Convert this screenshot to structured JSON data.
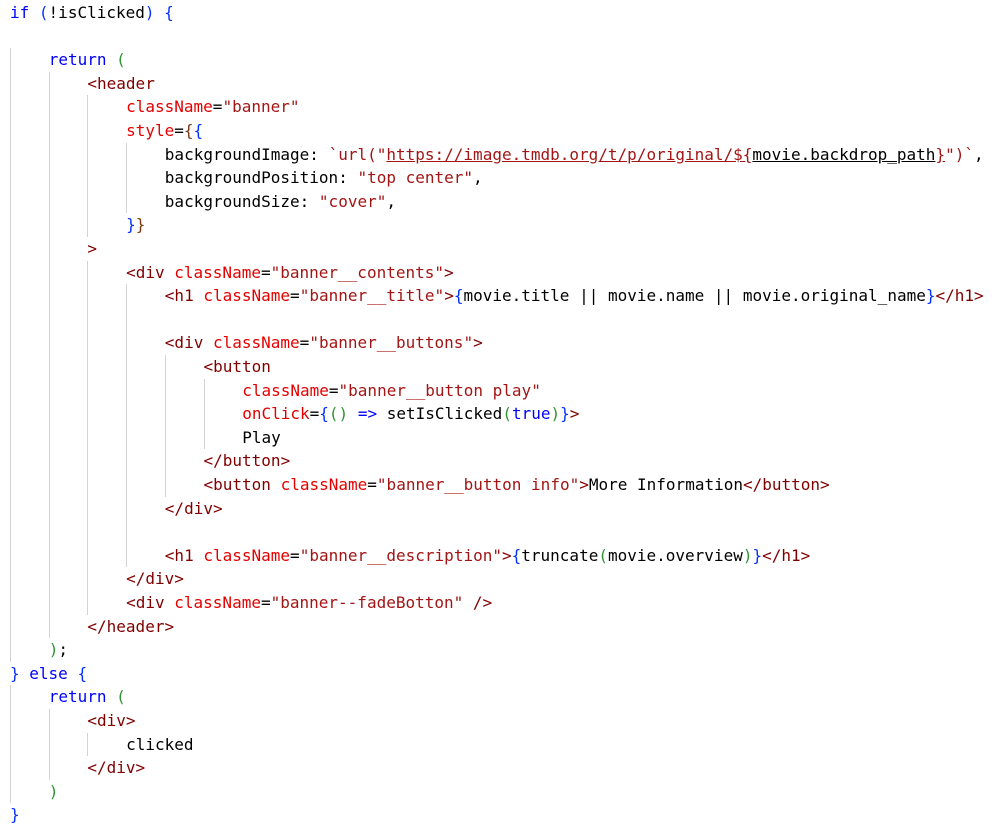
{
  "colors": {
    "default": "#000000",
    "keyword": "#0000ff",
    "control": "#af00db",
    "tag": "#800000",
    "attr": "#e50000",
    "string": "#a31515",
    "bracket1": "#0431fa",
    "bracket2": "#319331",
    "bracket3": "#7b3814",
    "indent_guide": "#d3d3d3"
  },
  "code": {
    "lines": [
      {
        "indent": 0,
        "tokens": [
          {
            "t": "if",
            "c": "keyword"
          },
          {
            "t": " ",
            "c": "default"
          },
          {
            "t": "(",
            "c": "bracket1"
          },
          {
            "t": "!isClicked",
            "c": "default"
          },
          {
            "t": ")",
            "c": "bracket1"
          },
          {
            "t": " ",
            "c": "default"
          },
          {
            "t": "{",
            "c": "bracket1"
          }
        ]
      },
      {
        "indent": 0,
        "tokens": []
      },
      {
        "indent": 1,
        "tokens": [
          {
            "t": "return",
            "c": "keyword"
          },
          {
            "t": " ",
            "c": "default"
          },
          {
            "t": "(",
            "c": "bracket2"
          }
        ]
      },
      {
        "indent": 2,
        "tokens": [
          {
            "t": "<header",
            "c": "tag"
          }
        ]
      },
      {
        "indent": 3,
        "tokens": [
          {
            "t": "className",
            "c": "attr"
          },
          {
            "t": "=",
            "c": "default"
          },
          {
            "t": "\"banner\"",
            "c": "string"
          }
        ]
      },
      {
        "indent": 3,
        "tokens": [
          {
            "t": "style",
            "c": "attr"
          },
          {
            "t": "=",
            "c": "default"
          },
          {
            "t": "{",
            "c": "bracket3"
          },
          {
            "t": "{",
            "c": "bracket1"
          }
        ]
      },
      {
        "indent": 4,
        "tokens": [
          {
            "t": "backgroundImage: ",
            "c": "default"
          },
          {
            "t": "`url(\"",
            "c": "string"
          },
          {
            "t": "https://image.tmdb.org/t/p/original/${",
            "c": "string",
            "link": true
          },
          {
            "t": "movie.backdrop_path",
            "c": "default",
            "link": true
          },
          {
            "t": "}",
            "c": "string",
            "link": true
          },
          {
            "t": "\")`",
            "c": "string"
          },
          {
            "t": ",",
            "c": "default"
          }
        ]
      },
      {
        "indent": 4,
        "tokens": [
          {
            "t": "backgroundPosition: ",
            "c": "default"
          },
          {
            "t": "\"top center\"",
            "c": "string"
          },
          {
            "t": ",",
            "c": "default"
          }
        ]
      },
      {
        "indent": 4,
        "tokens": [
          {
            "t": "backgroundSize: ",
            "c": "default"
          },
          {
            "t": "\"cover\"",
            "c": "string"
          },
          {
            "t": ",",
            "c": "default"
          }
        ]
      },
      {
        "indent": 3,
        "tokens": [
          {
            "t": "}",
            "c": "bracket1"
          },
          {
            "t": "}",
            "c": "bracket3"
          }
        ]
      },
      {
        "indent": 2,
        "tokens": [
          {
            "t": ">",
            "c": "tag"
          }
        ]
      },
      {
        "indent": 3,
        "tokens": [
          {
            "t": "<div",
            "c": "tag"
          },
          {
            "t": " ",
            "c": "default"
          },
          {
            "t": "className",
            "c": "attr"
          },
          {
            "t": "=",
            "c": "default"
          },
          {
            "t": "\"banner__contents\"",
            "c": "string"
          },
          {
            "t": ">",
            "c": "tag"
          }
        ]
      },
      {
        "indent": 4,
        "tokens": [
          {
            "t": "<h1",
            "c": "tag"
          },
          {
            "t": " ",
            "c": "default"
          },
          {
            "t": "className",
            "c": "attr"
          },
          {
            "t": "=",
            "c": "default"
          },
          {
            "t": "\"banner__title\"",
            "c": "string"
          },
          {
            "t": ">",
            "c": "tag"
          },
          {
            "t": "{",
            "c": "bracket1"
          },
          {
            "t": "movie.title || movie.name || movie.original_name",
            "c": "default"
          },
          {
            "t": "}",
            "c": "bracket1"
          },
          {
            "t": "</h1>",
            "c": "tag"
          }
        ]
      },
      {
        "indent": 4,
        "tokens": []
      },
      {
        "indent": 4,
        "tokens": [
          {
            "t": "<div",
            "c": "tag"
          },
          {
            "t": " ",
            "c": "default"
          },
          {
            "t": "className",
            "c": "attr"
          },
          {
            "t": "=",
            "c": "default"
          },
          {
            "t": "\"banner__buttons\"",
            "c": "string"
          },
          {
            "t": ">",
            "c": "tag"
          }
        ]
      },
      {
        "indent": 5,
        "tokens": [
          {
            "t": "<button",
            "c": "tag"
          }
        ]
      },
      {
        "indent": 6,
        "tokens": [
          {
            "t": "className",
            "c": "attr"
          },
          {
            "t": "=",
            "c": "default"
          },
          {
            "t": "\"banner__button play\"",
            "c": "string"
          }
        ]
      },
      {
        "indent": 6,
        "tokens": [
          {
            "t": "onClick",
            "c": "attr"
          },
          {
            "t": "=",
            "c": "default"
          },
          {
            "t": "{",
            "c": "bracket1"
          },
          {
            "t": "()",
            "c": "bracket2"
          },
          {
            "t": " ",
            "c": "default"
          },
          {
            "t": "=>",
            "c": "keyword"
          },
          {
            "t": " setIsClicked",
            "c": "default"
          },
          {
            "t": "(",
            "c": "bracket2"
          },
          {
            "t": "true",
            "c": "keyword"
          },
          {
            "t": ")",
            "c": "bracket2"
          },
          {
            "t": "}",
            "c": "bracket1"
          },
          {
            "t": ">",
            "c": "tag"
          }
        ]
      },
      {
        "indent": 6,
        "tokens": [
          {
            "t": "Play",
            "c": "default"
          }
        ]
      },
      {
        "indent": 5,
        "tokens": [
          {
            "t": "</button>",
            "c": "tag"
          }
        ]
      },
      {
        "indent": 5,
        "tokens": [
          {
            "t": "<button",
            "c": "tag"
          },
          {
            "t": " ",
            "c": "default"
          },
          {
            "t": "className",
            "c": "attr"
          },
          {
            "t": "=",
            "c": "default"
          },
          {
            "t": "\"banner__button info\"",
            "c": "string"
          },
          {
            "t": ">",
            "c": "tag"
          },
          {
            "t": "More Information",
            "c": "default"
          },
          {
            "t": "</button>",
            "c": "tag"
          }
        ]
      },
      {
        "indent": 4,
        "tokens": [
          {
            "t": "</div>",
            "c": "tag"
          }
        ]
      },
      {
        "indent": 4,
        "tokens": []
      },
      {
        "indent": 4,
        "tokens": [
          {
            "t": "<h1",
            "c": "tag"
          },
          {
            "t": " ",
            "c": "default"
          },
          {
            "t": "className",
            "c": "attr"
          },
          {
            "t": "=",
            "c": "default"
          },
          {
            "t": "\"banner__description\"",
            "c": "string"
          },
          {
            "t": ">",
            "c": "tag"
          },
          {
            "t": "{",
            "c": "bracket1"
          },
          {
            "t": "truncate",
            "c": "default"
          },
          {
            "t": "(",
            "c": "bracket2"
          },
          {
            "t": "movie.overview",
            "c": "default"
          },
          {
            "t": ")",
            "c": "bracket2"
          },
          {
            "t": "}",
            "c": "bracket1"
          },
          {
            "t": "</h1>",
            "c": "tag"
          }
        ]
      },
      {
        "indent": 3,
        "tokens": [
          {
            "t": "</div>",
            "c": "tag"
          }
        ]
      },
      {
        "indent": 3,
        "tokens": [
          {
            "t": "<div",
            "c": "tag"
          },
          {
            "t": " ",
            "c": "default"
          },
          {
            "t": "className",
            "c": "attr"
          },
          {
            "t": "=",
            "c": "default"
          },
          {
            "t": "\"banner--fadeBotton\"",
            "c": "string"
          },
          {
            "t": " ",
            "c": "default"
          },
          {
            "t": "/>",
            "c": "tag"
          }
        ]
      },
      {
        "indent": 2,
        "tokens": [
          {
            "t": "</header>",
            "c": "tag"
          }
        ]
      },
      {
        "indent": 1,
        "tokens": [
          {
            "t": ")",
            "c": "bracket2"
          },
          {
            "t": ";",
            "c": "default"
          }
        ]
      },
      {
        "indent": 0,
        "tokens": [
          {
            "t": "}",
            "c": "bracket1"
          },
          {
            "t": " ",
            "c": "default"
          },
          {
            "t": "else",
            "c": "keyword"
          },
          {
            "t": " ",
            "c": "default"
          },
          {
            "t": "{",
            "c": "bracket1"
          }
        ]
      },
      {
        "indent": 1,
        "tokens": [
          {
            "t": "return",
            "c": "keyword"
          },
          {
            "t": " ",
            "c": "default"
          },
          {
            "t": "(",
            "c": "bracket2"
          }
        ]
      },
      {
        "indent": 2,
        "tokens": [
          {
            "t": "<div>",
            "c": "tag"
          }
        ]
      },
      {
        "indent": 3,
        "tokens": [
          {
            "t": "clicked",
            "c": "default"
          }
        ]
      },
      {
        "indent": 2,
        "tokens": [
          {
            "t": "</div>",
            "c": "tag"
          }
        ]
      },
      {
        "indent": 1,
        "tokens": [
          {
            "t": ")",
            "c": "bracket2"
          }
        ]
      },
      {
        "indent": 0,
        "tokens": [
          {
            "t": "}",
            "c": "bracket1"
          }
        ]
      }
    ]
  }
}
